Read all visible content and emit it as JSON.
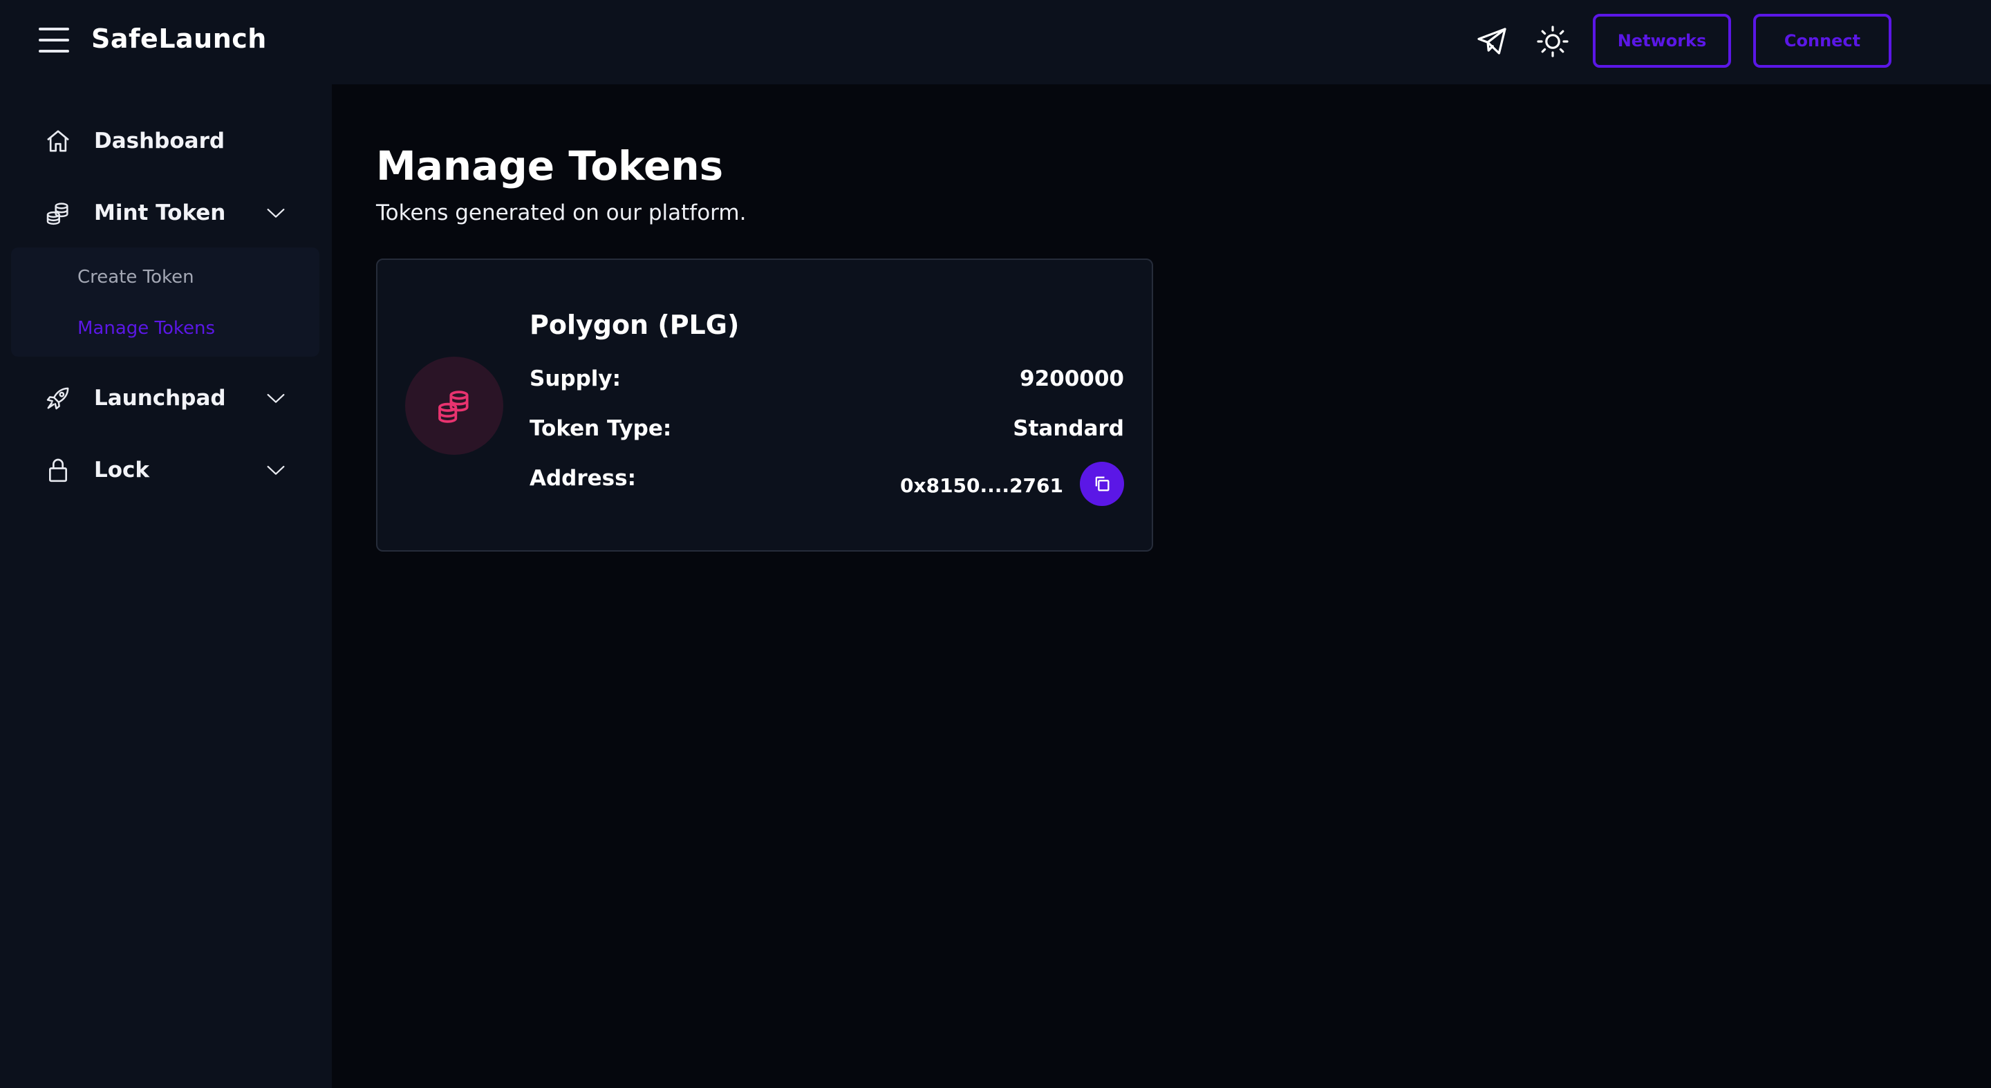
{
  "header": {
    "brand": "SafeLaunch",
    "networks_label": "Networks",
    "connect_label": "Connect",
    "icons": [
      "menu-icon",
      "telegram-icon",
      "sun-icon"
    ]
  },
  "sidebar": {
    "items": [
      {
        "label": "Dashboard",
        "icon": "home-icon"
      },
      {
        "label": "Mint Token",
        "icon": "coins-icon",
        "expanded": true,
        "children": [
          {
            "label": "Create Token",
            "active": false
          },
          {
            "label": "Manage Tokens",
            "active": true
          }
        ]
      },
      {
        "label": "Launchpad",
        "icon": "rocket-icon"
      },
      {
        "label": "Lock",
        "icon": "lock-icon"
      }
    ]
  },
  "main": {
    "title": "Manage Tokens",
    "subtitle": "Tokens generated on our platform.",
    "tokens": [
      {
        "name": "Polygon (PLG)",
        "supply_label": "Supply:",
        "supply": "9200000",
        "type_label": "Token Type:",
        "type": "Standard",
        "address_label": "Address:",
        "address": "0x8150....2761",
        "icon": "coins-icon"
      }
    ]
  },
  "colors": {
    "accent": "#5b17e6",
    "token_icon": "#e8336f",
    "background": "#05070d",
    "panel": "#0c111c"
  }
}
